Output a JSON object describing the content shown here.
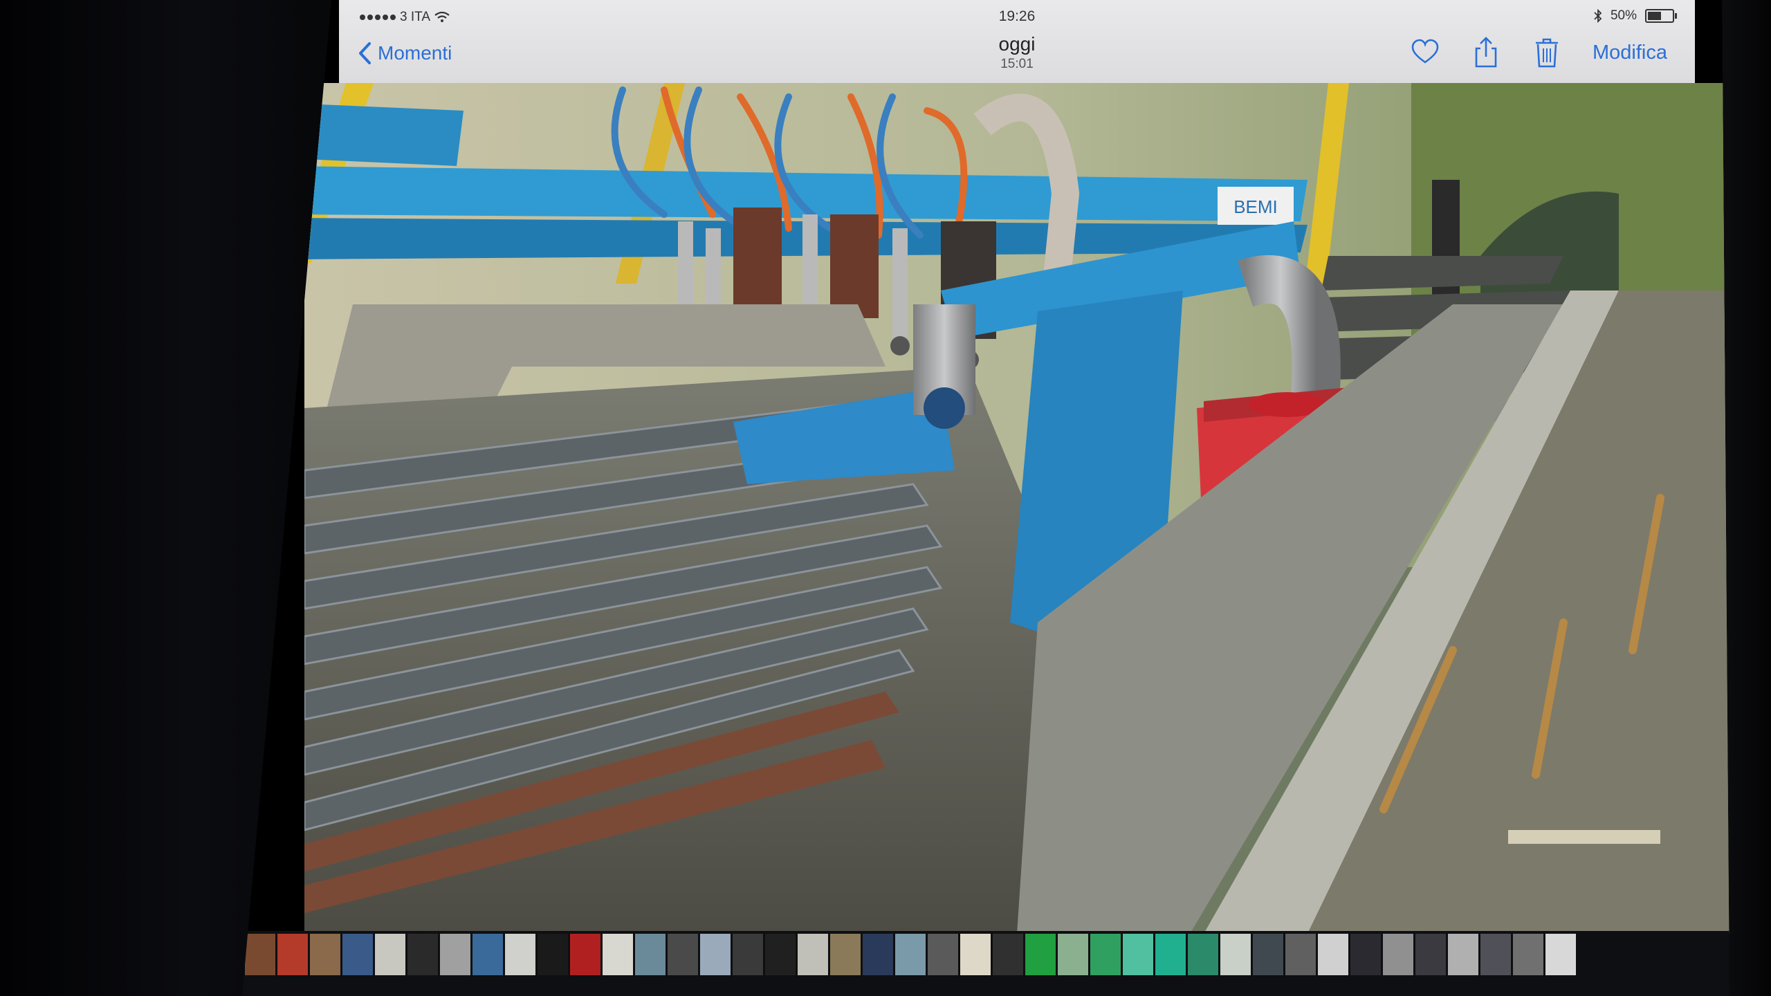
{
  "status_bar": {
    "carrier": "3 ITA",
    "time": "19:26",
    "battery": "50%"
  },
  "nav": {
    "back_label": "Momenti",
    "title": "oggi",
    "subtitle": "15:01",
    "edit_label": "Modifica"
  },
  "icons": {
    "back": "chevron-left-icon",
    "favorite": "heart-icon",
    "share": "share-icon",
    "delete": "trash-icon",
    "wifi": "wifi-icon",
    "bluetooth": "bluetooth-icon",
    "battery": "battery-icon"
  },
  "photo": {
    "machine_label": "BEMI"
  },
  "accent_color": "#2b6fd6",
  "thumbnail_colors": [
    "#7a4a30",
    "#b43a2a",
    "#8a6a4a",
    "#3a5a8a",
    "#c8c8c0",
    "#2a2a2a",
    "#a0a0a0",
    "#3a6a9a",
    "#d0d0cc",
    "#1a1a1a",
    "#b02020",
    "#d8d8d0",
    "#6a8a9a",
    "#4a4a4a",
    "#9aaaba",
    "#3a3a3a",
    "#202020",
    "#c0c0b8",
    "#8a7a5a",
    "#2a3a5a",
    "#7a9aaa",
    "#5a5a5a",
    "#ded8c8",
    "#303030",
    "#20a040",
    "#8ab090",
    "#30a060",
    "#50c0a0",
    "#20b090",
    "#2a8a6a",
    "#c8d0c8",
    "#404850",
    "#606060",
    "#d0d0d0",
    "#2a2a30",
    "#909090",
    "#3a3a40",
    "#b0b0b0",
    "#505058",
    "#707070",
    "#d8d8d8"
  ]
}
